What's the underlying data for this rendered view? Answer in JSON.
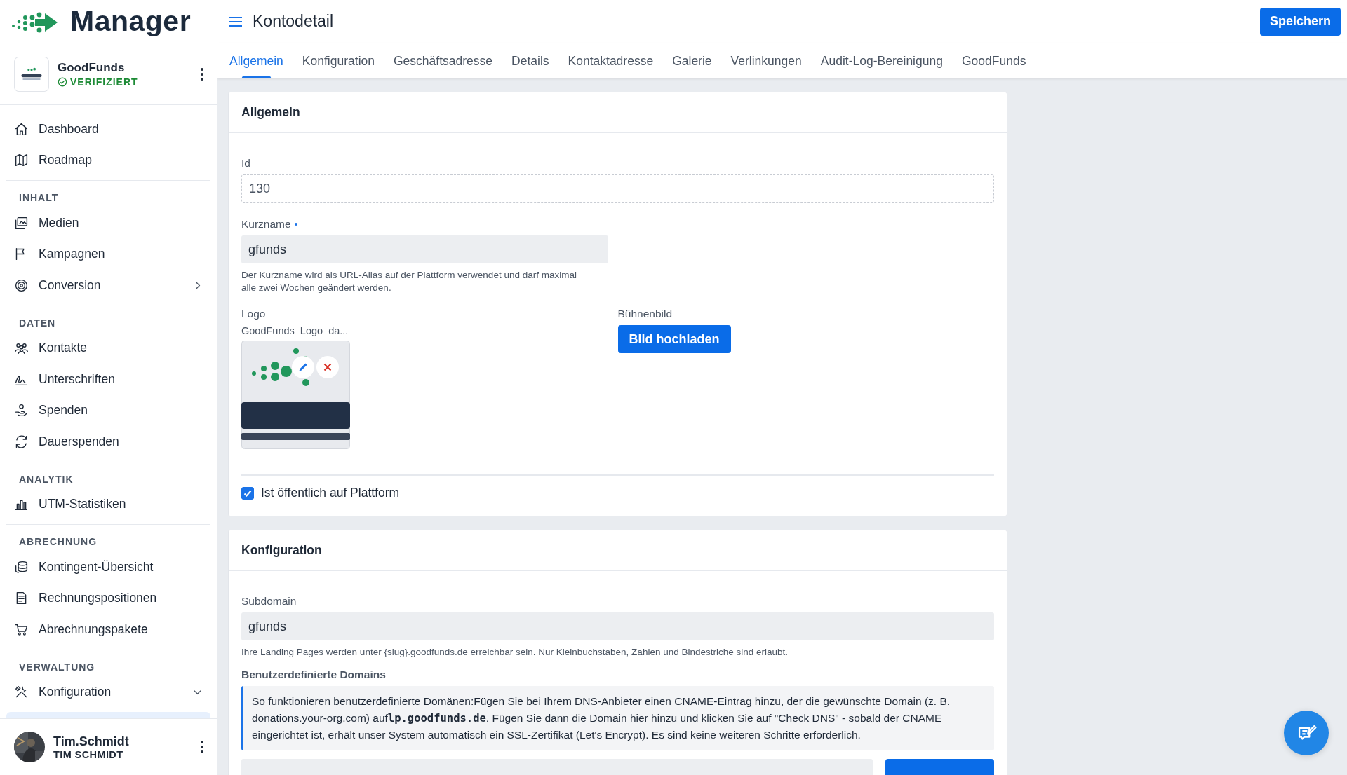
{
  "brand": {
    "name": "Manager"
  },
  "account": {
    "name": "GoodFunds",
    "status": "VERIFIZIERT",
    "verified": true
  },
  "sidebar": {
    "groups": [
      {
        "items": [
          {
            "label": "Dashboard"
          },
          {
            "label": "Roadmap"
          }
        ]
      },
      {
        "heading": "INHALT",
        "items": [
          {
            "label": "Medien"
          },
          {
            "label": "Kampagnen"
          },
          {
            "label": "Conversion",
            "expanded": false
          }
        ]
      },
      {
        "heading": "DATEN",
        "items": [
          {
            "label": "Kontakte"
          },
          {
            "label": "Unterschriften"
          },
          {
            "label": "Spenden"
          },
          {
            "label": "Dauerspenden"
          }
        ]
      },
      {
        "heading": "ANALYTIK",
        "items": [
          {
            "label": "UTM-Statistiken"
          }
        ]
      },
      {
        "heading": "ABRECHNUNG",
        "items": [
          {
            "label": "Kontingent-Übersicht"
          },
          {
            "label": "Rechnungspositionen"
          },
          {
            "label": "Abrechnungspakete"
          }
        ]
      },
      {
        "heading": "VERWALTUNG",
        "items": [
          {
            "label": "Konfiguration",
            "expanded": true
          }
        ]
      }
    ]
  },
  "user": {
    "login": "Tim.Schmidt",
    "name": "TIM SCHMIDT"
  },
  "header": {
    "title": "Kontodetail",
    "save_button": "Speichern"
  },
  "tabs": [
    {
      "label": "Allgemein",
      "selected": true
    },
    {
      "label": "Konfiguration",
      "selected": false
    },
    {
      "label": "Geschäftsadresse",
      "selected": false
    },
    {
      "label": "Details",
      "selected": false
    },
    {
      "label": "Kontaktadresse",
      "selected": false
    },
    {
      "label": "Galerie",
      "selected": false
    },
    {
      "label": "Verlinkungen",
      "selected": false
    },
    {
      "label": "Audit-Log-Bereinigung",
      "selected": false
    },
    {
      "label": "GoodFunds",
      "selected": false
    }
  ],
  "general": {
    "title": "Allgemein",
    "id": {
      "label": "Id",
      "value": "130"
    },
    "short_name": {
      "label": "Kurzname",
      "required": true,
      "value": "gfunds",
      "help": "Der Kurzname wird als URL-Alias auf der Plattform verwendet und darf maximal alle zwei Wochen geändert werden."
    },
    "logo": {
      "label": "Logo",
      "filename": "GoodFunds_Logo_da..."
    },
    "stage_image": {
      "label": "Bühnenbild",
      "button": "Bild hochladen"
    },
    "public": {
      "label": "Ist öffentlich auf Plattform",
      "checked": true
    }
  },
  "configuration": {
    "title": "Konfiguration",
    "subdomain": {
      "label": "Subdomain",
      "value": "gfunds",
      "help": "Ihre Landing Pages werden unter {slug}.goodfunds.de erreichbar sein. Nur Kleinbuchstaben, Zahlen und Bindestriche sind erlaubt."
    },
    "custom_domains": {
      "heading": "Benutzerdefinierte Domains",
      "info": "So funktionieren benutzerdefinierte Domänen:Fügen Sie bei Ihrem DNS-Anbieter einen CNAME-Eintrag hinzu, der die gewünschte Domain (z. B. donations.your-org.com) auf**lp.goodfunds.de**. Fügen Sie dann die Domain hier hinzu und klicken Sie auf \"Check DNS\" - sobald der CNAME eingerichtet ist, erhält unser System automatisch ein SSL-Zertifikat (Let's Encrypt). Es sind keine weiteren Schritte erforderlich."
    }
  }
}
